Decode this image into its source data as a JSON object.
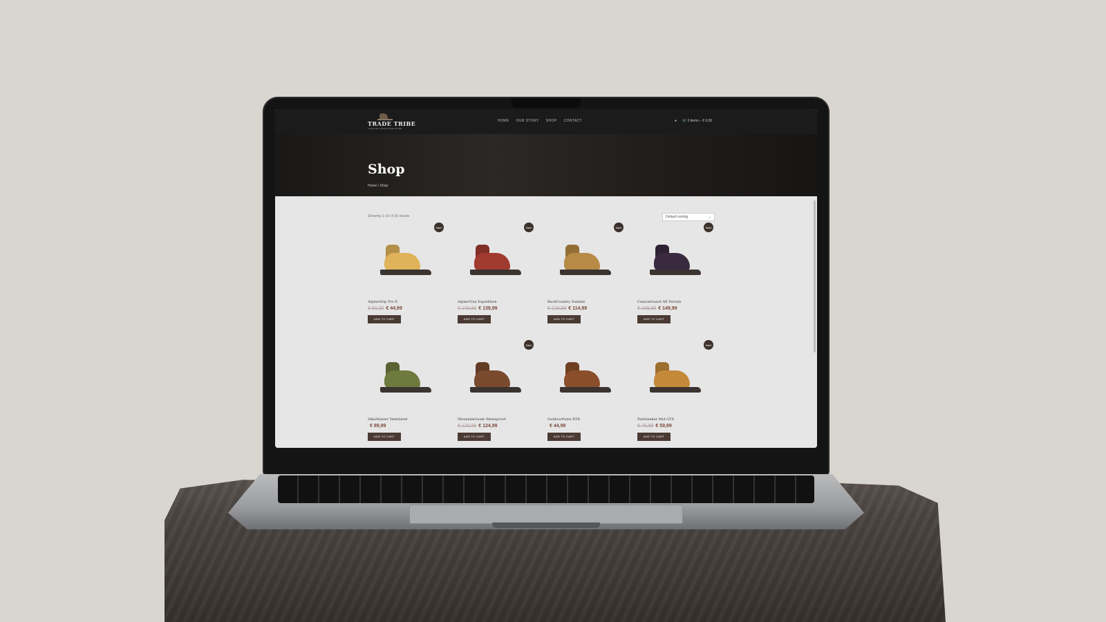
{
  "site": {
    "brand": "TRADE TRIBE",
    "tagline": "YOUR ONLY HIKING SHOE STORE",
    "nav": [
      "HOME",
      "OUR STORY",
      "SHOP",
      "CONTACT"
    ],
    "cart_summary": "0 items – € 0,00"
  },
  "hero": {
    "title": "Shop",
    "breadcrumb": "Home / Shop"
  },
  "shop": {
    "result_count": "Showing 1–16 of 20 results",
    "sort_selected": "Default sorting",
    "sale_label": "Sale!",
    "cart_label": "ADD TO CART",
    "products": [
      {
        "name": "AlpineGrip Pro X",
        "old_price": "€ 50,00",
        "price": "€ 44,99",
        "sale": true,
        "color": "#e0b35a"
      },
      {
        "name": "AlpineTrax Expedition",
        "old_price": "€ 149,99",
        "price": "€ 139,99",
        "sale": true,
        "color": "#a13a2f"
      },
      {
        "name": "BackCountry Summit",
        "old_price": "€ 129,99",
        "price": "€ 114,99",
        "sale": true,
        "color": "#b78a45"
      },
      {
        "name": "CanyonGuard All Terrain",
        "old_price": "€ 199,99",
        "price": "€ 149,99",
        "sale": true,
        "color": "#3a2a3f"
      },
      {
        "name": "HikeMaster Ventilated",
        "old_price": "",
        "price": "€ 89,99",
        "sale": false,
        "color": "#6f7a3f"
      },
      {
        "name": "MountainGuide Waterproof",
        "old_price": "€ 129,99",
        "price": "€ 124,99",
        "sale": true,
        "color": "#7a4a2f"
      },
      {
        "name": "OutdoorPulse XTR",
        "old_price": "",
        "price": "€ 44,99",
        "sale": false,
        "color": "#8a4f2a"
      },
      {
        "name": "PathSeeker Mid GTX",
        "old_price": "€ 79,99",
        "price": "€ 59,99",
        "sale": true,
        "color": "#c48a3a"
      }
    ]
  }
}
